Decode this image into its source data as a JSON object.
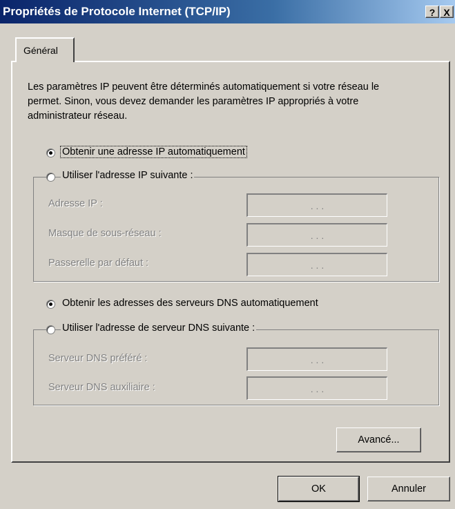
{
  "window": {
    "title": "Propriétés de Protocole Internet (TCP/IP)",
    "help_glyph": "?",
    "close_glyph": "X"
  },
  "tabs": [
    {
      "label": "Général"
    }
  ],
  "description": "Les paramètres IP peuvent être déterminés automatiquement si votre réseau le permet. Sinon, vous devez demander les paramètres IP appropriés à votre administrateur réseau.",
  "ip": {
    "auto_label": "Obtenir une adresse IP automatiquement",
    "auto_selected": true,
    "manual_label": "Utiliser l'adresse IP suivante :",
    "fields": [
      {
        "label": "Adresse IP :",
        "value": ". . ."
      },
      {
        "label": "Masque de sous-réseau :",
        "value": ". . ."
      },
      {
        "label": "Passerelle par défaut :",
        "value": ". . ."
      }
    ]
  },
  "dns": {
    "auto_label": "Obtenir les adresses des serveurs DNS automatiquement",
    "auto_selected": true,
    "manual_label": "Utiliser l'adresse de serveur DNS suivante :",
    "fields": [
      {
        "label": "Serveur DNS préféré :",
        "value": ". . ."
      },
      {
        "label": "Serveur DNS auxiliaire :",
        "value": ". . ."
      }
    ]
  },
  "buttons": {
    "advanced": "Avancé...",
    "ok": "OK",
    "cancel": "Annuler"
  },
  "colors": {
    "dialog_bg": "#d4d0c8",
    "title_start": "#0a246a",
    "title_end": "#a6caf0",
    "disabled_text": "#808080"
  }
}
